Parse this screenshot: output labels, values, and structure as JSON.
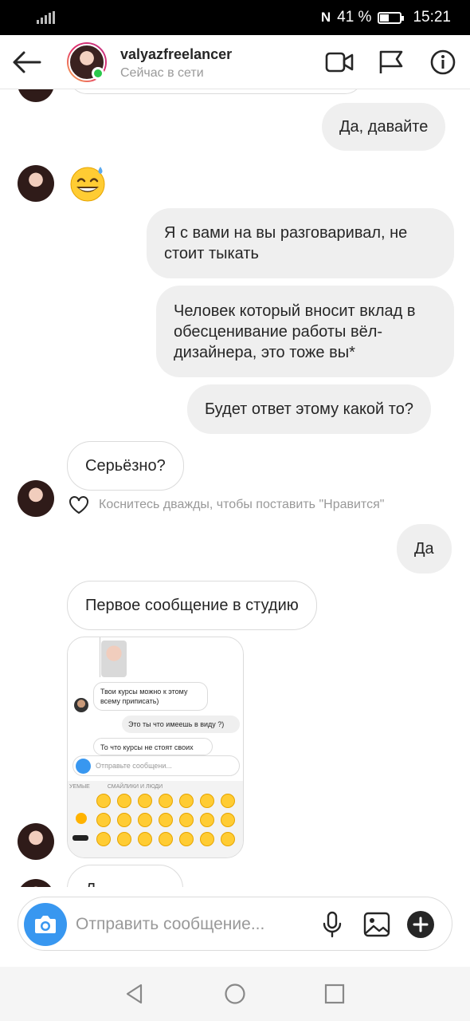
{
  "status_bar": {
    "battery": "41 %",
    "time": "15:21"
  },
  "header": {
    "username": "valyazfreelancer",
    "status": "Сейчас в сети"
  },
  "messages": {
    "m1": "Да, давайте",
    "m2": "Я с вами на вы разговаривал, не стоит тыкать",
    "m3": "Человек который вносит вклад в обесценивание работы вёл-дизайнера, это тоже вы*",
    "m4": "Будет ответ этому какой то?",
    "m5": "Серьёзно?",
    "m6": "Да",
    "m7": "Первое сообщение в студию",
    "m8_partial": "Д"
  },
  "like_hint": "Коснитесь дважды, чтобы поставить \"Нравится\"",
  "screenshot": {
    "bubble1": "Твои курсы можно к этому всему приписать)",
    "bubble2": "Это ты что имеешь в виду ?)",
    "bubble3": "То что курсы не стоят своих",
    "input_placeholder": "Отправьте сообщени...",
    "kb_label_left": "УЕМЫЕ",
    "kb_label_right": "СМАЙЛИКИ И ЛЮДИ"
  },
  "composer": {
    "placeholder": "Отправить сообщение..."
  },
  "icons": [
    "back-arrow-icon",
    "video-call-icon",
    "flag-icon",
    "info-icon",
    "heart-icon",
    "camera-icon",
    "microphone-icon",
    "gallery-icon",
    "plus-icon",
    "nav-back-icon",
    "nav-home-icon",
    "nav-recents-icon"
  ],
  "colors": {
    "accent": "#3897f0",
    "online": "#2ac84b",
    "bubble_out": "#efefef"
  }
}
